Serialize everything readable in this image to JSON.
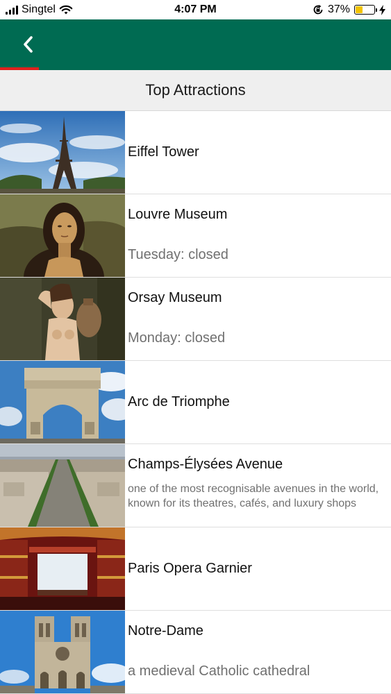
{
  "status_bar": {
    "carrier": "Singtel",
    "time": "4:07 PM",
    "battery": "37%",
    "battery_level": 0.37
  },
  "header": {
    "back_icon": "chevron-left-icon",
    "bar_color": "#006b52",
    "indicator_color": "#e0211d"
  },
  "section": {
    "title": "Top Attractions"
  },
  "attractions": [
    {
      "title": "Eiffel Tower",
      "subtitle": ""
    },
    {
      "title": "Louvre Museum",
      "subtitle": "Tuesday: closed"
    },
    {
      "title": "Orsay Museum",
      "subtitle": "Monday: closed"
    },
    {
      "title": "Arc de Triomphe",
      "subtitle": ""
    },
    {
      "title": "Champs-Élysées Avenue",
      "subtitle": "one of the most recognisable avenues in the world, known for its theatres, cafés, and luxury shops"
    },
    {
      "title": "Paris Opera Garnier",
      "subtitle": ""
    },
    {
      "title": "Notre-Dame",
      "subtitle": "a medieval Catholic cathedral"
    }
  ]
}
